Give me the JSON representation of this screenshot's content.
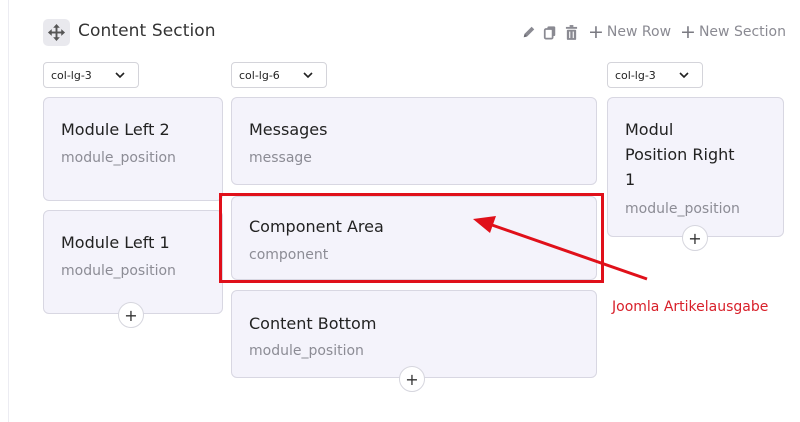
{
  "section": {
    "title": "Content Section",
    "actions": {
      "new_row": "New Row",
      "new_section": "New Section"
    }
  },
  "columns": [
    {
      "class_select": "col-lg-3",
      "modules": [
        {
          "title": "Module Left 2",
          "subtitle": "module_position"
        },
        {
          "title": "Module Left 1",
          "subtitle": "module_position"
        }
      ]
    },
    {
      "class_select": "col-lg-6",
      "modules": [
        {
          "title": "Messages",
          "subtitle": "message"
        },
        {
          "title": "Component Area",
          "subtitle": "component"
        },
        {
          "title": "Content Bottom",
          "subtitle": "module_position"
        }
      ]
    },
    {
      "class_select": "col-lg-3",
      "modules": [
        {
          "title_lines": [
            "Modul",
            "Position Right",
            "1"
          ],
          "subtitle": "module_position"
        }
      ]
    }
  ],
  "add_symbol": "+",
  "annotation": {
    "text": "Joomla Artikelausgabe",
    "color": "#e0101a"
  },
  "icons": {
    "move": "move-arrows-icon",
    "edit": "pencil-icon",
    "copy": "copy-icon",
    "delete": "trash-icon",
    "add": "plus-icon",
    "dropdown": "chevron-down-icon"
  }
}
